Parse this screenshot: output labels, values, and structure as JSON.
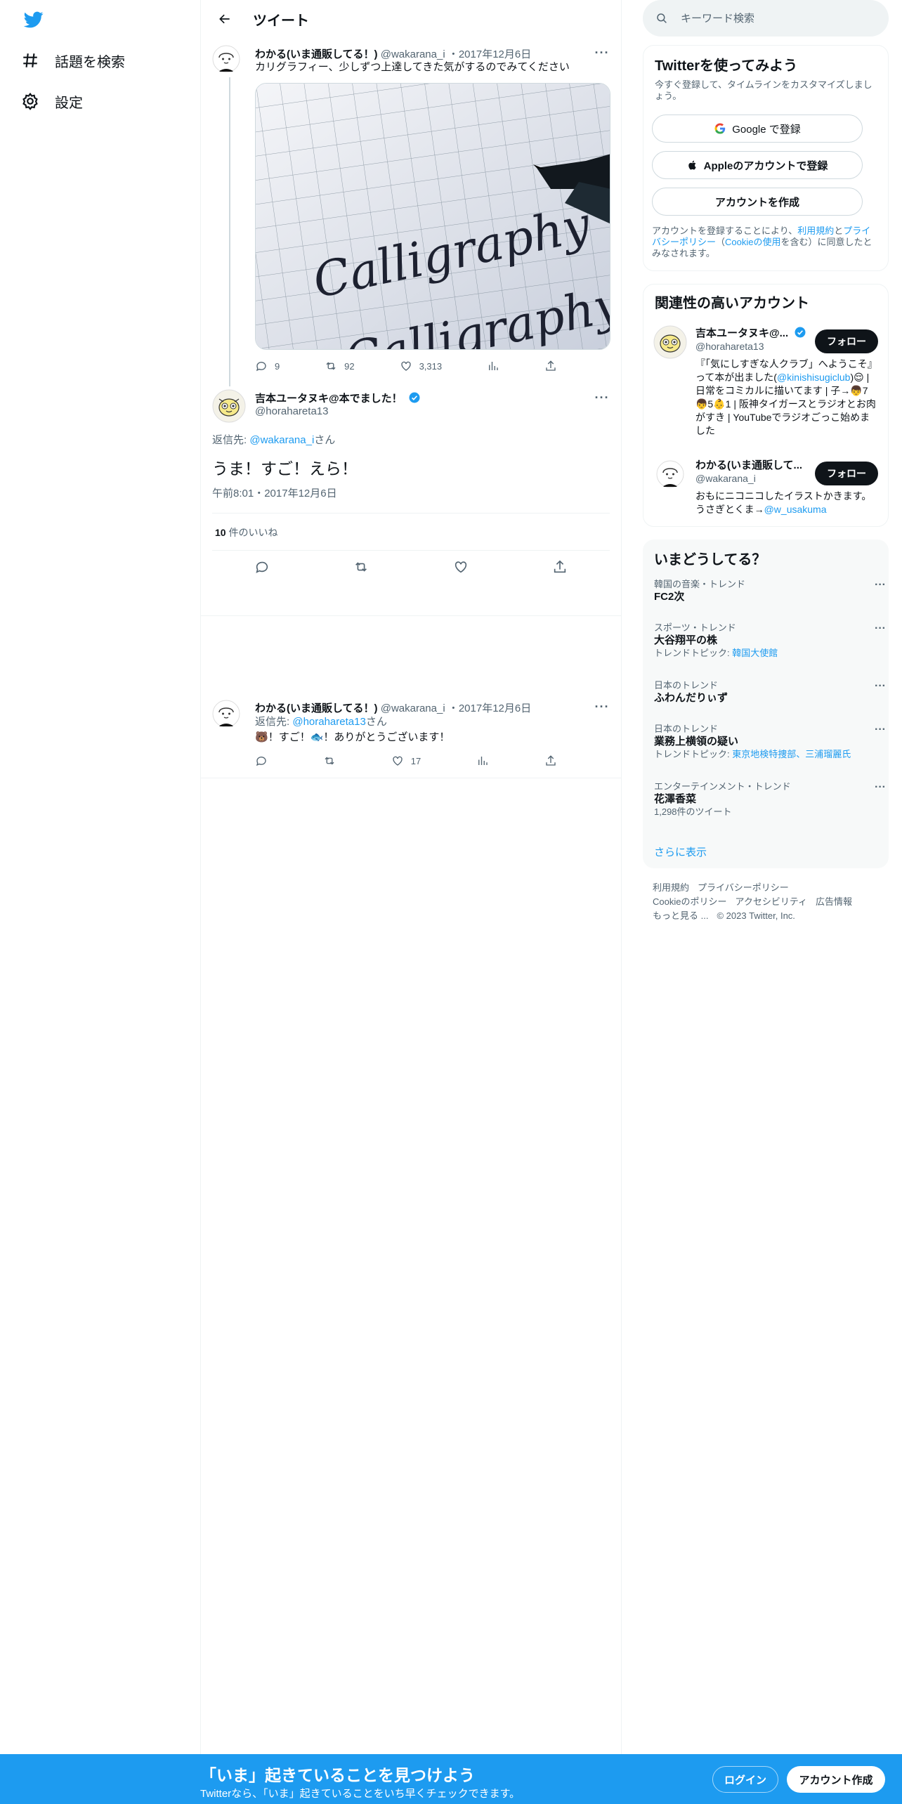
{
  "nav": {
    "explore_label": "話題を検索",
    "settings_label": "設定"
  },
  "header": {
    "title": "ツイート"
  },
  "parent_tweet": {
    "name": "わかる(いま通販してる！)",
    "handle": "@wakarana_i",
    "date": "・2017年12月6日",
    "text": "カリグラフィー、少しずつ上達してきた気がするのでみてください",
    "media_text_1": "Calligraphy",
    "media_text_2": "Calligraphy",
    "replies": "9",
    "retweets": "92",
    "likes": "3,313"
  },
  "main_tweet": {
    "name": "吉本ユータヌキ@本でました！",
    "handle": "@horahareta13",
    "reply_prefix": "返信先: ",
    "reply_to": "@wakarana_i",
    "reply_suffix": "さん",
    "text": "うま！すご！えら！",
    "timestamp": "午前8:01・2017年12月6日",
    "likes_count": "10",
    "likes_label": "件のいいね"
  },
  "reply_tweet": {
    "name": "わかる(いま通販してる！)",
    "handle": "@wakarana_i",
    "date": "・2017年12月6日",
    "reply_prefix": "返信先: ",
    "reply_to": "@horahareta13",
    "reply_suffix": "さん",
    "text_1": "！すご！",
    "text_2": "！ありがとうございます！",
    "likes": "17"
  },
  "search": {
    "placeholder": "キーワード検索"
  },
  "signup_card": {
    "title": "Twitterを使ってみよう",
    "subtitle": "今すぐ登録して、タイムラインをカスタマイズしましょう。",
    "google_label": "Google で登録",
    "apple_label": "Appleのアカウントで登録",
    "create_label": "アカウントを作成",
    "legal_1": "アカウントを登録することにより、",
    "legal_terms": "利用規約",
    "legal_2": "と",
    "legal_privacy": "プライバシーポリシー",
    "legal_3": "（",
    "legal_cookie": "Cookieの使用",
    "legal_4": "を含む）に同意したとみなされます。"
  },
  "relevant_card": {
    "title": "関連性の高いアカウント",
    "follow_label": "フォロー",
    "accounts": [
      {
        "name": "吉本ユータヌキ@...",
        "handle": "@horahareta13",
        "bio_1": "『「気にしすぎな人クラブ」へようこそ』って本が出ました(",
        "bio_link": "@kinishisugiclub",
        "bio_2": ")😌 | 日常をコミカルに描いてます | 子→👦7👦5👶1 | 阪神タイガースとラジオとお肉がすき | YouTubeでラジオごっこ始めました"
      },
      {
        "name": "わかる(いま通販して...",
        "handle": "@wakarana_i",
        "bio_1": "おもにニコニコしたイラストかきます。うさぎとくま→",
        "bio_link": "@w_usakuma",
        "bio_2": ""
      }
    ]
  },
  "trends_card": {
    "title": "いまどうしてる？",
    "trends": [
      {
        "meta": "韓国の音楽・トレンド",
        "name": "FC2次",
        "extra_label": "",
        "extra_link": ""
      },
      {
        "meta": "スポーツ・トレンド",
        "name": "大谷翔平の株",
        "extra_label": "トレンドトピック: ",
        "extra_link": "韓国大使館"
      },
      {
        "meta": "日本のトレンド",
        "name": "ふわんだりぃず",
        "extra_label": "",
        "extra_link": ""
      },
      {
        "meta": "日本のトレンド",
        "name": "業務上横領の疑い",
        "extra_label": "トレンドトピック: ",
        "extra_link": "東京地検特捜部、三浦瑠麗氏"
      },
      {
        "meta": "エンターテインメント・トレンド",
        "name": "花澤香菜",
        "extra_label": "1,298件のツイート",
        "extra_link": ""
      }
    ],
    "show_more": "さらに表示"
  },
  "footer": {
    "terms": "利用規約",
    "privacy": "プライバシーポリシー",
    "cookie": "Cookieのポリシー",
    "accessibility": "アクセシビリティ",
    "ads": "広告情報",
    "more": "もっと見る ...",
    "copyright": "© 2023 Twitter, Inc."
  },
  "banner": {
    "title": "「いま」起きていることを見つけよう",
    "subtitle": "Twitterなら、「いま」起きていることをいち早くチェックできます。",
    "login": "ログイン",
    "signup": "アカウント作成"
  },
  "colors": {
    "accent": "#1d9bf0",
    "text": "#0f1419",
    "muted": "#536471",
    "border": "#eff3f4"
  }
}
